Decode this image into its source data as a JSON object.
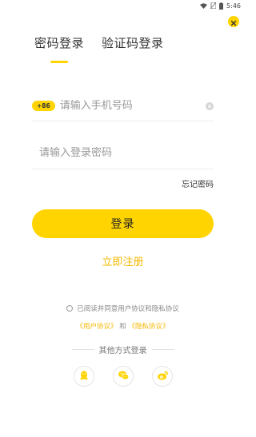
{
  "status_bar": {
    "time": "5:46",
    "icons": [
      "wifi-icon",
      "no-sim-icon",
      "battery-icon"
    ]
  },
  "close": {
    "icon": "close-icon"
  },
  "tabs": [
    {
      "label": "密码登录",
      "active": true
    },
    {
      "label": "验证码登录",
      "active": false
    }
  ],
  "phone_field": {
    "country_code": "+86",
    "placeholder": "请输入手机号码",
    "value": "",
    "clear_icon": "clear-icon"
  },
  "password_field": {
    "placeholder": "请输入登录密码",
    "value": ""
  },
  "forgot_password": "忘记密码",
  "login_button": "登录",
  "register_link": "立即注册",
  "agreement": {
    "text": "已阅读并同意用户协议和隐私协议",
    "user_agreement": "《用户协议》",
    "and": "和",
    "privacy_agreement": "《隐私协议》"
  },
  "other_login": {
    "title": "其他方式登录",
    "methods": [
      "qq-icon",
      "wechat-icon",
      "weibo-icon"
    ]
  },
  "colors": {
    "accent": "#FFD400",
    "link": "#F5B800",
    "text": "#333333",
    "placeholder": "#999999"
  }
}
